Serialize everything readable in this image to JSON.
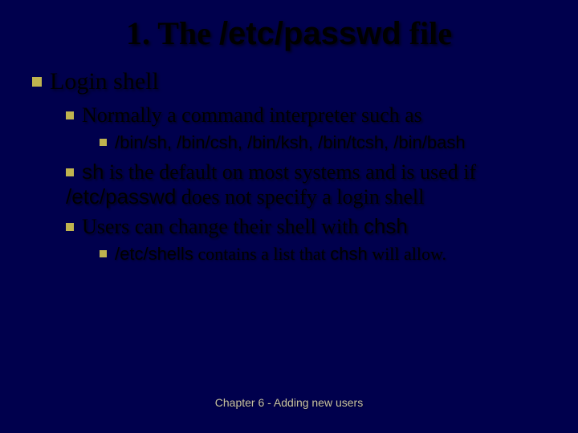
{
  "title": {
    "pre": "1. The ",
    "code": "/etc/passwd",
    "post": " file"
  },
  "lvl1": {
    "text": "Login shell"
  },
  "lvl2_1": {
    "text": "Normally a command interpreter such as"
  },
  "lvl3_1": {
    "text": "/bin/sh, /bin/csh, /bin/ksh, /bin/tcsh, /bin/bash"
  },
  "lvl2_2": {
    "code1": "sh",
    "mid": " is the default on most systems and is used if ",
    "code2": "/etc/passwd",
    "post": " does not specify a login shell"
  },
  "lvl2_3": {
    "pre": "Users can change their shell with ",
    "code": "chsh"
  },
  "lvl3_2": {
    "code1": "/etc/shells",
    "mid": " contains a list that ",
    "code2": "chsh",
    "post": " will allow."
  },
  "footer": "Chapter 6 - Adding new users"
}
